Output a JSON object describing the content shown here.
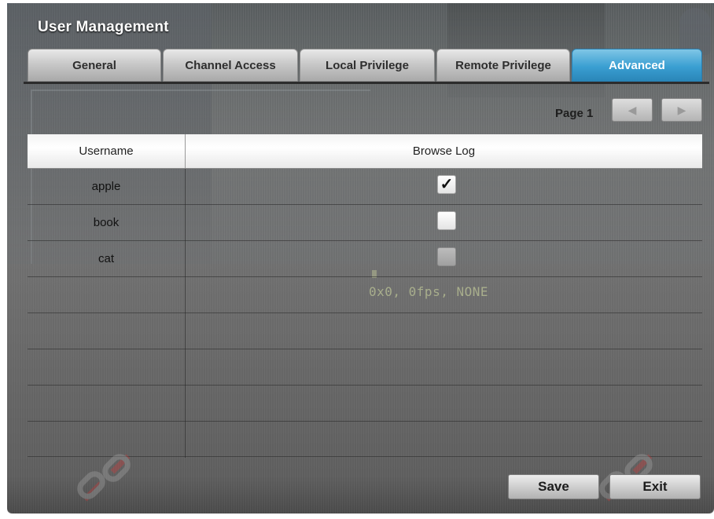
{
  "window": {
    "title": "User Management"
  },
  "tabs": [
    {
      "label": "General",
      "active": false
    },
    {
      "label": "Channel Access",
      "active": false
    },
    {
      "label": "Local Privilege",
      "active": false
    },
    {
      "label": "Remote Privilege",
      "active": false
    },
    {
      "label": "Advanced",
      "active": true
    }
  ],
  "pager": {
    "label": "Page 1",
    "prev_icon": "triangle-left-icon",
    "next_icon": "triangle-right-icon"
  },
  "table": {
    "headers": [
      "Username",
      "Browse Log"
    ],
    "rows": [
      {
        "username": "apple",
        "browse_log": "checked",
        "enabled": true
      },
      {
        "username": "book",
        "browse_log": "unchecked",
        "enabled": true
      },
      {
        "username": "cat",
        "browse_log": "unchecked",
        "enabled": false
      },
      {
        "username": "",
        "browse_log": "",
        "enabled": false
      },
      {
        "username": "",
        "browse_log": "",
        "enabled": false
      },
      {
        "username": "",
        "browse_log": "",
        "enabled": false
      },
      {
        "username": "",
        "browse_log": "",
        "enabled": false
      },
      {
        "username": "",
        "browse_log": "",
        "enabled": false
      }
    ]
  },
  "video_overlay": {
    "text": "0x0, 0fps, NONE"
  },
  "buttons": {
    "save": "Save",
    "exit": "Exit"
  },
  "colors": {
    "active_tab": "#3a9fd2",
    "panel": "#6a6a6a"
  }
}
